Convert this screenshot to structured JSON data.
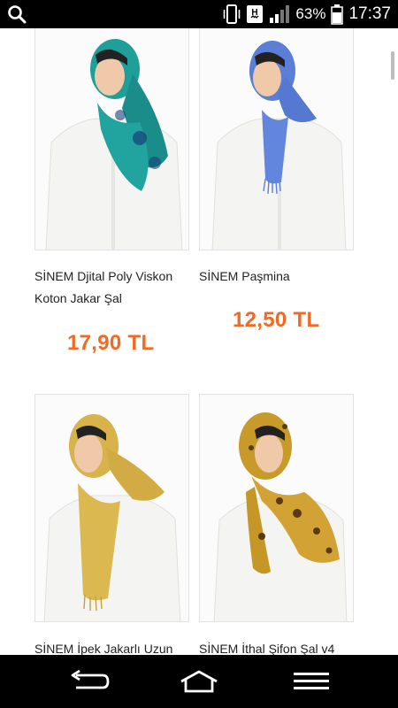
{
  "status_bar": {
    "battery_percent": "63%",
    "time": "17:37",
    "network": "H"
  },
  "products": [
    {
      "title": "SİNEM Djital Poly Viskon Koton Jakar Şal",
      "price": "17,90 TL",
      "scarf_color": "#1f9e9a"
    },
    {
      "title": "SİNEM Paşmina",
      "price": "12,50 TL",
      "scarf_color": "#5b7fd6"
    },
    {
      "title": "SİNEM İpek Jakarlı Uzun",
      "price": "",
      "scarf_color": "#d8b24a"
    },
    {
      "title": "SİNEM İthal Şifon Şal v4",
      "price": "",
      "scarf_color": "#c89a2a"
    }
  ],
  "nav": {
    "back": "back-icon",
    "home": "home-icon",
    "menu": "menu-icon"
  }
}
